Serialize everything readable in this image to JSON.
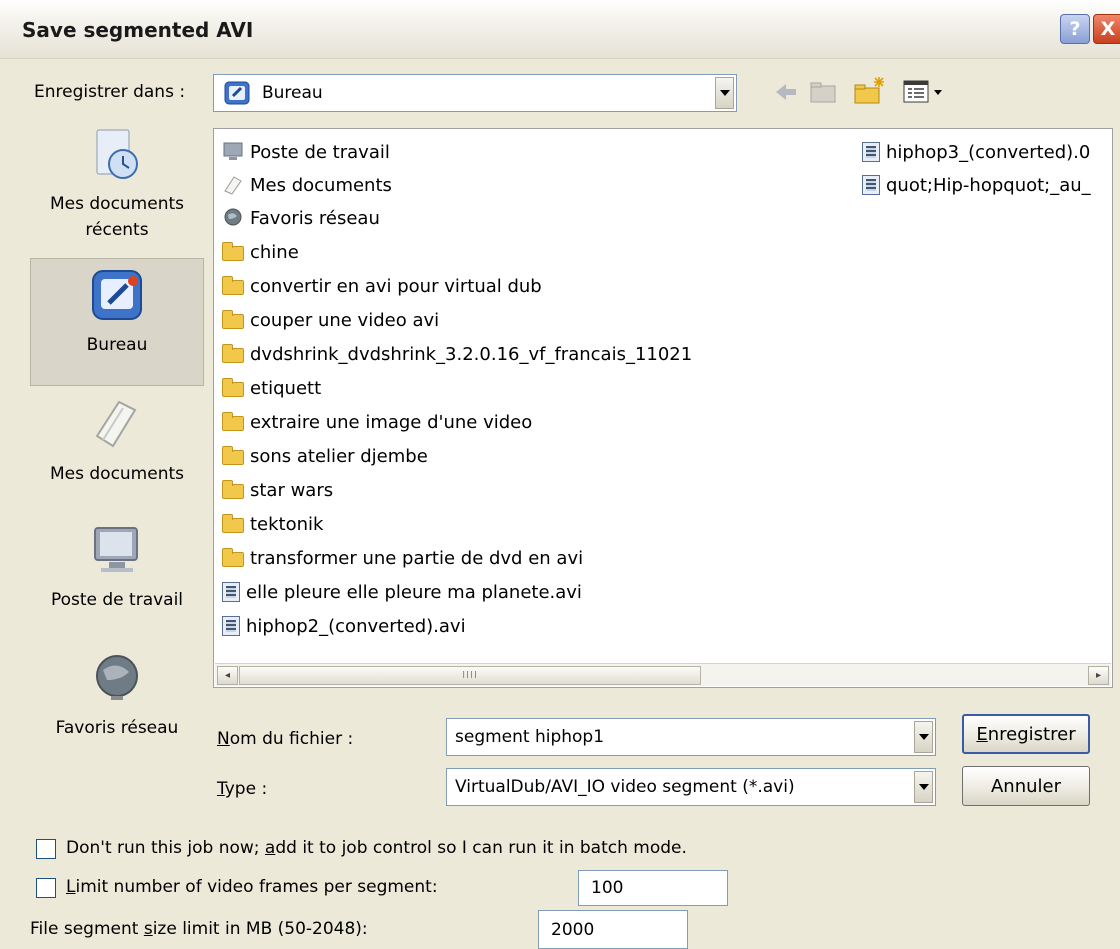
{
  "window": {
    "title": "Save segmented AVI",
    "help": "?",
    "close": "X"
  },
  "lookin": {
    "label": "Enregistrer dans :",
    "value": "Bureau"
  },
  "places": [
    {
      "label": "Mes documents récents",
      "icon": "recent-documents-icon"
    },
    {
      "label": "Bureau",
      "icon": "desktop-icon"
    },
    {
      "label": "Mes documents",
      "icon": "my-documents-icon"
    },
    {
      "label": "Poste de travail",
      "icon": "my-computer-icon"
    },
    {
      "label": "Favoris réseau",
      "icon": "network-places-icon"
    }
  ],
  "files": {
    "col1": [
      {
        "name": "Poste de travail",
        "icon": "computer-icon"
      },
      {
        "name": "Mes documents",
        "icon": "documents-icon"
      },
      {
        "name": "Favoris réseau",
        "icon": "network-icon"
      },
      {
        "name": "chine",
        "icon": "folder-icon"
      },
      {
        "name": "convertir en avi pour virtual dub",
        "icon": "folder-icon"
      },
      {
        "name": "couper une video avi",
        "icon": "folder-icon"
      },
      {
        "name": "dvdshrink_dvdshrink_3.2.0.16_vf_francais_11021",
        "icon": "folder-icon"
      },
      {
        "name": "etiquett",
        "icon": "folder-icon"
      },
      {
        "name": "extraire une image d'une video",
        "icon": "folder-icon"
      },
      {
        "name": "sons atelier djembe",
        "icon": "folder-icon"
      },
      {
        "name": "star wars",
        "icon": "folder-icon"
      },
      {
        "name": "tektonik",
        "icon": "folder-icon"
      },
      {
        "name": "transformer une partie de dvd en avi",
        "icon": "folder-icon"
      },
      {
        "name": "elle pleure elle pleure ma planete.avi",
        "icon": "avi-file-icon"
      },
      {
        "name": "hiphop2_(converted).avi",
        "icon": "avi-file-icon"
      }
    ],
    "col2": [
      {
        "name": "hiphop3_(converted).0",
        "icon": "avi-file-icon"
      },
      {
        "name": "quot;Hip-hopquot;_au_",
        "icon": "avi-file-icon"
      }
    ]
  },
  "scrollbar": {
    "left": "◂",
    "right": "▸",
    "grip": "IIII"
  },
  "filename": {
    "label_u": "N",
    "label_rest": "om du fichier :",
    "value": "segment hiphop1"
  },
  "filetype": {
    "label_u": "T",
    "label_rest": "ype :",
    "value": "VirtualDub/AVI_IO video segment (*.avi)"
  },
  "buttons": {
    "save_u": "E",
    "save_rest": "nregistrer",
    "cancel": "Annuler"
  },
  "options": {
    "batch_pre": "Don't run this job now; ",
    "batch_u": "a",
    "batch_post": "dd it to job control so I can run it in batch mode.",
    "limit_u": "L",
    "limit_rest": "imit number of video frames per segment:",
    "limit_value": "100",
    "size_pre": "File segment ",
    "size_u": "s",
    "size_post": "ize limit in MB (50-2048):",
    "size_value": "2000"
  }
}
